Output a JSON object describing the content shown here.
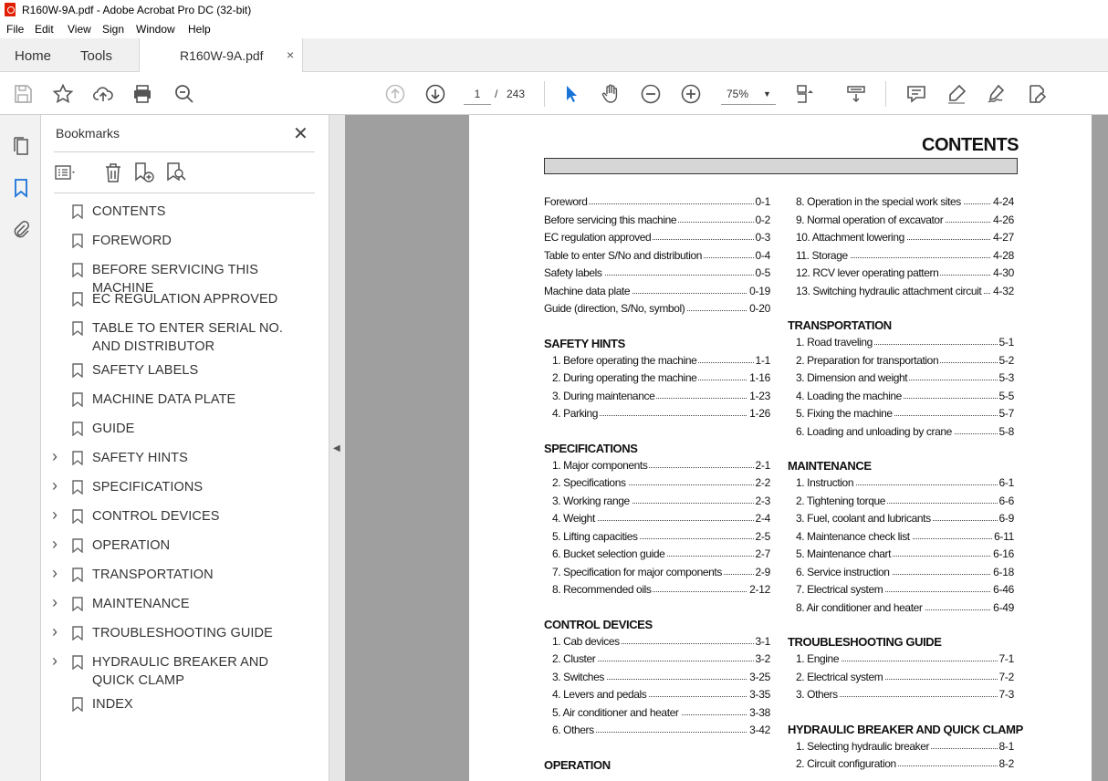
{
  "window": {
    "title": "R160W-9A.pdf - Adobe Acrobat Pro DC (32-bit)"
  },
  "menu": [
    "File",
    "Edit",
    "View",
    "Sign",
    "Window",
    "Help"
  ],
  "tabs": {
    "home": "Home",
    "tools": "Tools",
    "document": "R160W-9A.pdf",
    "close": "×"
  },
  "toolbar": {
    "page_current": "1",
    "page_separator": "/",
    "page_total": "243",
    "zoom": "75%"
  },
  "bookmarks": {
    "header": "Bookmarks",
    "close": "✕",
    "items": [
      {
        "label": "CONTENTS",
        "expandable": false
      },
      {
        "label": "FOREWORD",
        "expandable": false
      },
      {
        "label": "BEFORE SERVICING THIS MACHINE",
        "expandable": false
      },
      {
        "label": "EC REGULATION APPROVED",
        "expandable": false
      },
      {
        "label": "TABLE TO ENTER SERIAL NO. AND DISTRIBUTOR",
        "expandable": false
      },
      {
        "label": "SAFETY LABELS",
        "expandable": false
      },
      {
        "label": "MACHINE DATA PLATE",
        "expandable": false
      },
      {
        "label": "GUIDE",
        "expandable": false
      },
      {
        "label": "SAFETY HINTS",
        "expandable": true
      },
      {
        "label": "SPECIFICATIONS",
        "expandable": true
      },
      {
        "label": "CONTROL DEVICES",
        "expandable": true
      },
      {
        "label": "OPERATION",
        "expandable": true
      },
      {
        "label": "TRANSPORTATION",
        "expandable": true
      },
      {
        "label": "MAINTENANCE",
        "expandable": true
      },
      {
        "label": "TROUBLESHOOTING GUIDE",
        "expandable": true
      },
      {
        "label": "HYDRAULIC BREAKER AND QUICK CLAMP",
        "expandable": true
      },
      {
        "label": "INDEX",
        "expandable": false
      }
    ]
  },
  "document": {
    "title": "CONTENTS",
    "left_column": [
      {
        "type": "entry",
        "text": "Foreword",
        "page": "0-1",
        "indent": false
      },
      {
        "type": "entry",
        "text": "Before servicing this machine",
        "page": "0-2",
        "indent": false
      },
      {
        "type": "entry",
        "text": "EC regulation approved",
        "page": "0-3",
        "indent": false
      },
      {
        "type": "entry",
        "text": "Table to enter S/No and distribution",
        "page": "0-4",
        "indent": false
      },
      {
        "type": "entry",
        "text": "Safety labels",
        "page": "0-5",
        "indent": false
      },
      {
        "type": "entry",
        "text": "Machine data plate",
        "page": "0-19",
        "indent": false
      },
      {
        "type": "entry",
        "text": "Guide (direction, S/No, symbol)",
        "page": "0-20",
        "indent": false
      },
      {
        "type": "gap"
      },
      {
        "type": "head",
        "text": "SAFETY HINTS"
      },
      {
        "type": "entry",
        "text": "1. Before operating the machine",
        "page": "1-1",
        "indent": true
      },
      {
        "type": "entry",
        "text": "2. During operating the machine",
        "page": "1-16",
        "indent": true
      },
      {
        "type": "entry",
        "text": "3. During maintenance",
        "page": "1-23",
        "indent": true
      },
      {
        "type": "entry",
        "text": "4. Parking",
        "page": "1-26",
        "indent": true
      },
      {
        "type": "gap"
      },
      {
        "type": "head",
        "text": "SPECIFICATIONS"
      },
      {
        "type": "entry",
        "text": "1. Major components",
        "page": "2-1",
        "indent": true
      },
      {
        "type": "entry",
        "text": "2. Specifications",
        "page": "2-2",
        "indent": true
      },
      {
        "type": "entry",
        "text": "3. Working range",
        "page": "2-3",
        "indent": true
      },
      {
        "type": "entry",
        "text": "4. Weight",
        "page": "2-4",
        "indent": true
      },
      {
        "type": "entry",
        "text": "5. Lifting capacities",
        "page": "2-5",
        "indent": true
      },
      {
        "type": "entry",
        "text": "6. Bucket selection guide",
        "page": "2-7",
        "indent": true
      },
      {
        "type": "entry",
        "text": "7. Specification for major components",
        "page": "2-9",
        "indent": true
      },
      {
        "type": "entry",
        "text": "8. Recommended oils",
        "page": "2-12",
        "indent": true
      },
      {
        "type": "gap"
      },
      {
        "type": "head",
        "text": "CONTROL DEVICES"
      },
      {
        "type": "entry",
        "text": "1. Cab devices",
        "page": "3-1",
        "indent": true
      },
      {
        "type": "entry",
        "text": "2. Cluster",
        "page": "3-2",
        "indent": true
      },
      {
        "type": "entry",
        "text": "3. Switches",
        "page": "3-25",
        "indent": true
      },
      {
        "type": "entry",
        "text": "4. Levers and pedals",
        "page": "3-35",
        "indent": true
      },
      {
        "type": "entry",
        "text": "5. Air conditioner and heater",
        "page": "3-38",
        "indent": true
      },
      {
        "type": "entry",
        "text": "6. Others",
        "page": "3-42",
        "indent": true
      },
      {
        "type": "gap"
      },
      {
        "type": "head",
        "text": "OPERATION"
      }
    ],
    "right_column": [
      {
        "type": "entry",
        "text": "8. Operation in the special work sites",
        "page": "4-24",
        "indent": true
      },
      {
        "type": "entry",
        "text": "9. Normal operation of excavator",
        "page": "4-26",
        "indent": true
      },
      {
        "type": "entry",
        "text": "10. Attachment lowering",
        "page": "4-27",
        "indent": true
      },
      {
        "type": "entry",
        "text": "11. Storage",
        "page": "4-28",
        "indent": true
      },
      {
        "type": "entry",
        "text": "12. RCV lever operating pattern",
        "page": "4-30",
        "indent": true
      },
      {
        "type": "entry",
        "text": "13. Switching hydraulic attachment circuit",
        "page": "4-32",
        "indent": true
      },
      {
        "type": "gap"
      },
      {
        "type": "head",
        "text": "TRANSPORTATION"
      },
      {
        "type": "entry",
        "text": "1. Road traveling",
        "page": "5-1",
        "indent": true
      },
      {
        "type": "entry",
        "text": "2. Preparation for transportation",
        "page": "5-2",
        "indent": true
      },
      {
        "type": "entry",
        "text": "3. Dimension and weight",
        "page": "5-3",
        "indent": true
      },
      {
        "type": "entry",
        "text": "4. Loading the machine",
        "page": "5-5",
        "indent": true
      },
      {
        "type": "entry",
        "text": "5. Fixing the machine",
        "page": "5-7",
        "indent": true
      },
      {
        "type": "entry",
        "text": "6. Loading and unloading by crane",
        "page": "5-8",
        "indent": true
      },
      {
        "type": "gap"
      },
      {
        "type": "head",
        "text": "MAINTENANCE"
      },
      {
        "type": "entry",
        "text": "1. Instruction",
        "page": "6-1",
        "indent": true
      },
      {
        "type": "entry",
        "text": "2. Tightening torque",
        "page": "6-6",
        "indent": true
      },
      {
        "type": "entry",
        "text": "3. Fuel, coolant and lubricants",
        "page": "6-9",
        "indent": true
      },
      {
        "type": "entry",
        "text": "4. Maintenance check list",
        "page": "6-11",
        "indent": true
      },
      {
        "type": "entry",
        "text": "5. Maintenance chart",
        "page": "6-16",
        "indent": true
      },
      {
        "type": "entry",
        "text": "6. Service instruction",
        "page": "6-18",
        "indent": true
      },
      {
        "type": "entry",
        "text": "7. Electrical system",
        "page": "6-46",
        "indent": true
      },
      {
        "type": "entry",
        "text": "8. Air conditioner and heater",
        "page": "6-49",
        "indent": true
      },
      {
        "type": "gap"
      },
      {
        "type": "head",
        "text": "TROUBLESHOOTING GUIDE"
      },
      {
        "type": "entry",
        "text": "1. Engine",
        "page": "7-1",
        "indent": true
      },
      {
        "type": "entry",
        "text": "2. Electrical system",
        "page": "7-2",
        "indent": true
      },
      {
        "type": "entry",
        "text": "3. Others",
        "page": "7-3",
        "indent": true
      },
      {
        "type": "gap"
      },
      {
        "type": "head",
        "text": "HYDRAULIC BREAKER AND QUICK CLAMP"
      },
      {
        "type": "entry",
        "text": "1. Selecting hydraulic breaker",
        "page": "8-1",
        "indent": true
      },
      {
        "type": "entry",
        "text": "2. Circuit configuration",
        "page": "8-2",
        "indent": true
      }
    ]
  }
}
